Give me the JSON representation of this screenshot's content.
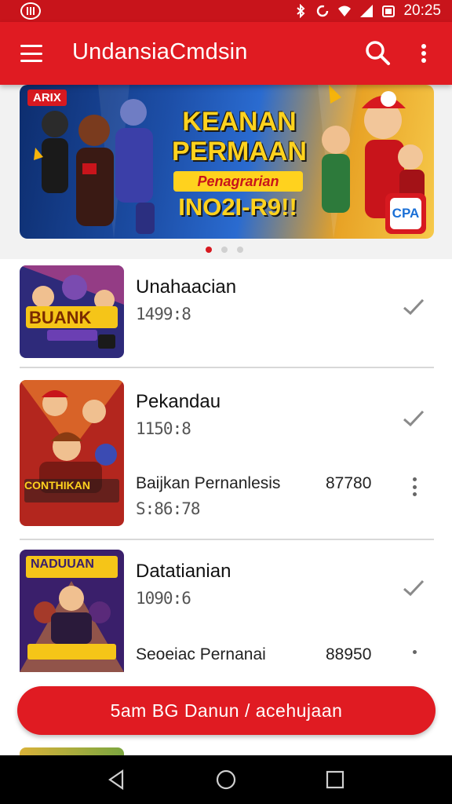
{
  "status_bar": {
    "time": "20:25",
    "icons": [
      "app-logo-icon",
      "bluetooth-icon",
      "sync-icon",
      "wifi-icon",
      "signal-icon",
      "battery-icon"
    ]
  },
  "app_bar": {
    "title": "UndansiaCmdsin",
    "menu_icon": "menu-icon",
    "search_icon": "search-icon",
    "more_icon": "more-vert-icon"
  },
  "banner": {
    "tag": "ARIX",
    "title": "KEANAN PERMAAN",
    "subtitle": "Penagrarian",
    "code": "INO2I-R9!!",
    "badge": "CPA",
    "page_count": 3,
    "active_page": 1
  },
  "list": {
    "items": [
      {
        "title": "Unahaacian",
        "subtitle": "1499:8",
        "thumb_caption": "BUANK",
        "action_icon": "check-icon"
      },
      {
        "title": "Pekandau",
        "subtitle": "1150:8",
        "thumb_caption": "CONTHIKAN",
        "row_label": "Baijkan Pernanlesis",
        "row_value": "87780",
        "row_sub": "S:86:78",
        "action_icon": "check-icon",
        "row_icon": "more-vert-icon"
      },
      {
        "title": "Datatianian",
        "subtitle": "1090:6",
        "thumb_caption": "NADUUAN",
        "row_label": "Seoeiac Pernanai",
        "row_value": "88950",
        "action_icon": "check-icon",
        "row_icon": "more-vert-icon"
      }
    ]
  },
  "cta": {
    "label": "5am BG Danun / acehujaan"
  },
  "nav_bar": {
    "icons": [
      "back-icon",
      "home-icon",
      "recents-icon"
    ]
  },
  "colors": {
    "primary": "#e01b22",
    "status_bar": "#c8141b",
    "nav_bar": "#000000"
  }
}
